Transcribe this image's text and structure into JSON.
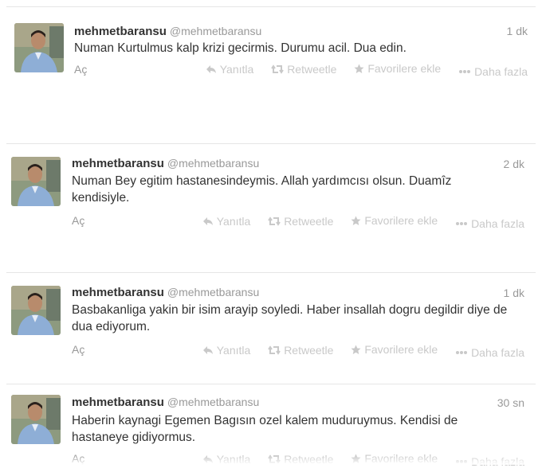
{
  "tweets": [
    {
      "name": "mehmetbaransu",
      "handle": "@mehmetbaransu",
      "time": "1 dk",
      "text": "Numan Kurtulmus kalp krizi gecirmis. Durumu acil. Dua edin.",
      "open": "Aç",
      "actions": [
        "Yanıtla",
        "Retweetle",
        "Favorilere ekle",
        "Daha fazla"
      ]
    },
    {
      "name": "mehmetbaransu",
      "handle": "@mehmetbaransu",
      "time": "2 dk",
      "text": "Numan Bey egitim hastanesindeymis. Allah yardımcısı olsun. Duamîz kendisiyle.",
      "open": "Aç",
      "actions": [
        "Yanıtla",
        "Retweetle",
        "Favorilere ekle",
        "Daha fazla"
      ]
    },
    {
      "name": "mehmetbaransu",
      "handle": "@mehmetbaransu",
      "time": "1 dk",
      "text": "Basbakanliga yakin bir isim arayip soyledi. Haber insallah dogru degildir diye de dua ediyorum.",
      "open": "Aç",
      "actions": [
        "Yanıtla",
        "Retweetle",
        "Favorilere ekle",
        "Daha fazla"
      ]
    },
    {
      "name": "mehmetbaransu",
      "handle": "@mehmetbaransu",
      "time": "30 sn",
      "text": "Haberin kaynagi Egemen Bagısın ozel kalem muduruymus. Kendisi de hastaneye gidiyormus.",
      "open": "Aç",
      "actions": [
        "Yanıtla",
        "Retweetle",
        "Favorilere ekle",
        "Daha fazla"
      ]
    }
  ],
  "icons": [
    "reply-icon",
    "retweet-icon",
    "favorite-star-icon",
    "more-dots-icon"
  ],
  "colors": {
    "text": "#333333",
    "muted": "#999999",
    "action": "#c9c9c9",
    "divider": "#e6e6e6"
  }
}
